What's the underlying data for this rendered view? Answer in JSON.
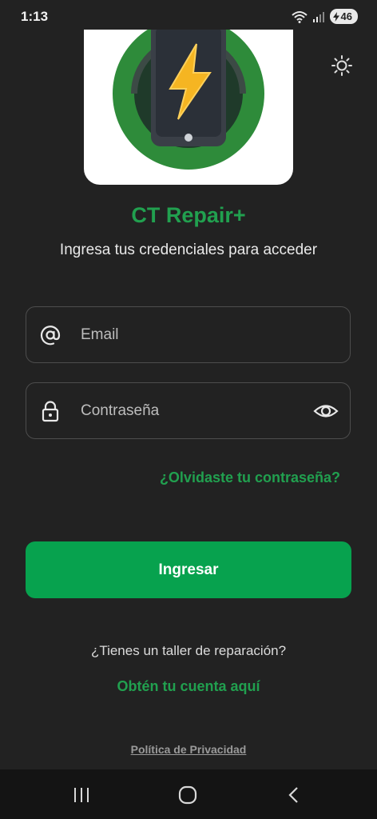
{
  "status_bar": {
    "time": "1:13",
    "battery": "46"
  },
  "app": {
    "title": "CT Repair+",
    "subtitle": "Ingresa tus credenciales para acceder"
  },
  "login_form": {
    "email": {
      "placeholder": "Email",
      "value": ""
    },
    "password": {
      "placeholder": "Contraseña",
      "value": ""
    },
    "forgot_password_label": "¿Olvidaste tu contraseña?",
    "submit_label": "Ingresar"
  },
  "signup": {
    "question": "¿Tienes un taller de reparación?",
    "link_label": "Obtén tu cuenta aquí"
  },
  "footer": {
    "privacy_label": "Política de Privacidad"
  },
  "icons": {
    "theme": "sun-icon",
    "email": "at-sign-icon",
    "password": "lock-icon",
    "toggle_visibility": "eye-icon",
    "nav_recents": "recents-icon",
    "nav_home": "home-icon",
    "nav_back": "back-icon"
  },
  "colors": {
    "accent": "#07a24e",
    "background": "#222222",
    "text_accent": "#21a04f"
  }
}
